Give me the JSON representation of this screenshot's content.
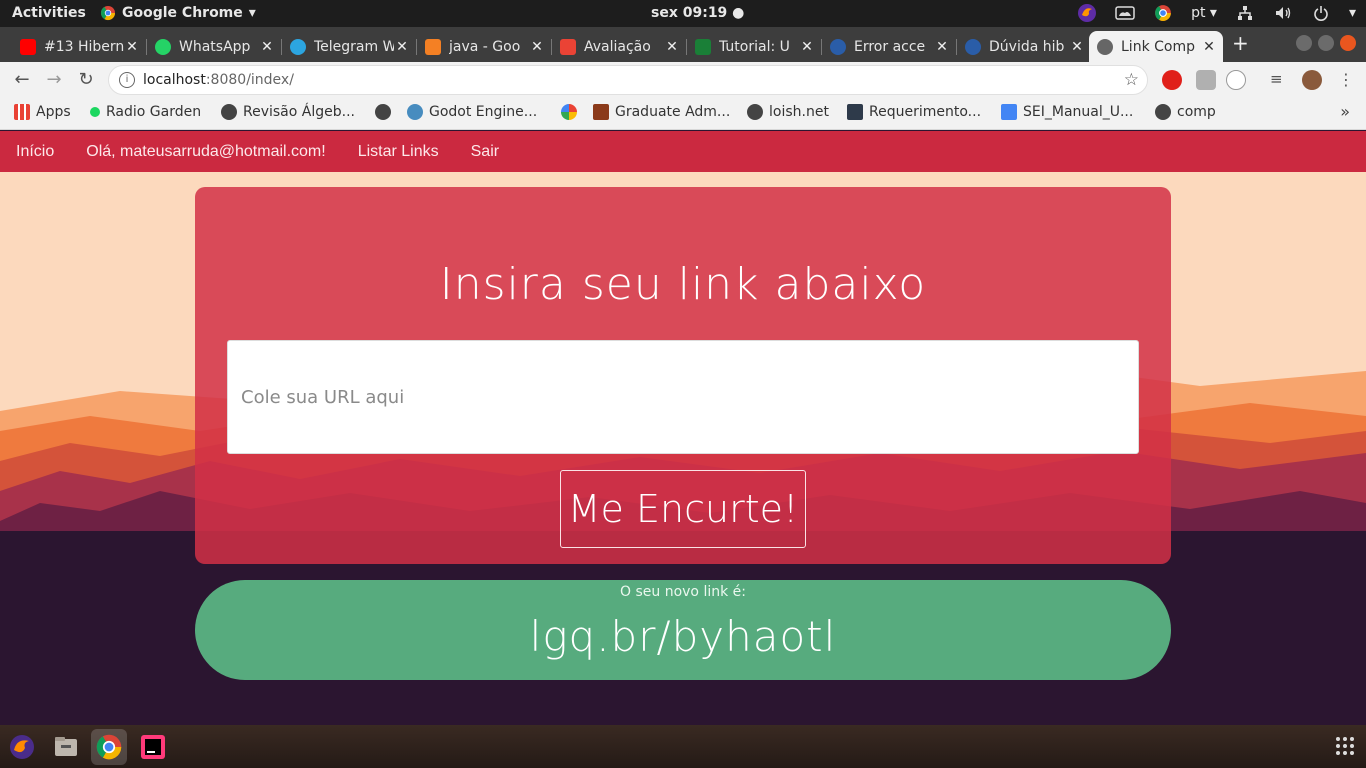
{
  "topbar": {
    "activities": "Activities",
    "app_name": "Google Chrome",
    "clock": "sex 09:19 ●",
    "language": "pt ▾"
  },
  "tabs": [
    {
      "label": "#13 Hibern",
      "icon": "youtube-icon",
      "color": "#ff0000"
    },
    {
      "label": "WhatsApp",
      "icon": "whatsapp-icon",
      "color": "#25d366"
    },
    {
      "label": "Telegram W",
      "icon": "telegram-icon",
      "color": "#2ca5e0"
    },
    {
      "label": "java - Goo",
      "icon": "stackoverflow-icon",
      "color": "#f48024"
    },
    {
      "label": "Avaliação",
      "icon": "gmail-icon",
      "color": "#ea4335"
    },
    {
      "label": "Tutorial: U",
      "icon": "check-icon",
      "color": "#1a7f37"
    },
    {
      "label": "Error acce",
      "icon": "forum-icon",
      "color": "#2a5da8"
    },
    {
      "label": "Dúvida hib",
      "icon": "forum-icon",
      "color": "#2a5da8"
    },
    {
      "label": "Link Comp",
      "icon": "globe-icon",
      "color": "#555555"
    }
  ],
  "address": {
    "host": "localhost",
    "path": ":8080/index/"
  },
  "bookmarks": [
    {
      "label": "Apps",
      "icon": "apps-grid-icon",
      "color": "#e94235"
    },
    {
      "label": "Radio Garden",
      "icon": "dot-icon",
      "color": "#1cd760"
    },
    {
      "label": "Revisão Álgeb...",
      "icon": "globe-icon",
      "color": "#444444"
    },
    {
      "label": "",
      "icon": "globe-icon",
      "color": "#444444"
    },
    {
      "label": "Godot Engine...",
      "icon": "godot-icon",
      "color": "#478cbf"
    },
    {
      "label": "",
      "icon": "google-icon",
      "color": "#4285f4"
    },
    {
      "label": "Graduate Adm...",
      "icon": "university-icon",
      "color": "#8b3a1a"
    },
    {
      "label": "loish.net",
      "icon": "globe-icon",
      "color": "#444444"
    },
    {
      "label": "Requerimento...",
      "icon": "tools-icon",
      "color": "#2e3a4a"
    },
    {
      "label": "SEI_Manual_U...",
      "icon": "docs-icon",
      "color": "#4285f4"
    },
    {
      "label": "comp",
      "icon": "globe-icon",
      "color": "#444444"
    }
  ],
  "site": {
    "nav": [
      "Início",
      "Olá, mateusarruda@hotmail.com!",
      "Listar Links",
      "Sair"
    ],
    "heading": "Insira seu link abaixo",
    "input_placeholder": "Cole sua URL aqui",
    "button_label": "Me Encurte!",
    "result_caption": "O seu novo link é:",
    "result_link": "lgq.br/byhaotl"
  },
  "colors": {
    "nav": "#cb2940",
    "card": "#d23046",
    "result": "#57ab7e",
    "sky": "#fcd9bd"
  }
}
